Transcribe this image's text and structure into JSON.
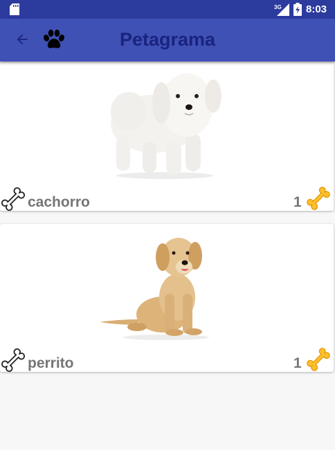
{
  "status_bar": {
    "time": "8:03",
    "network": "3G"
  },
  "app_bar": {
    "title": "Petagrama"
  },
  "pets": [
    {
      "name": "cachorro",
      "likes": "1",
      "image": "white-maltese-puppy"
    },
    {
      "name": "perrito",
      "likes": "1",
      "image": "golden-retriever-puppy"
    }
  ],
  "colors": {
    "status_bar": "#2c3b9e",
    "app_bar": "#3f51b5",
    "title": "#1a237e",
    "text": "#757575",
    "bone_gold": "#fbc02d"
  }
}
